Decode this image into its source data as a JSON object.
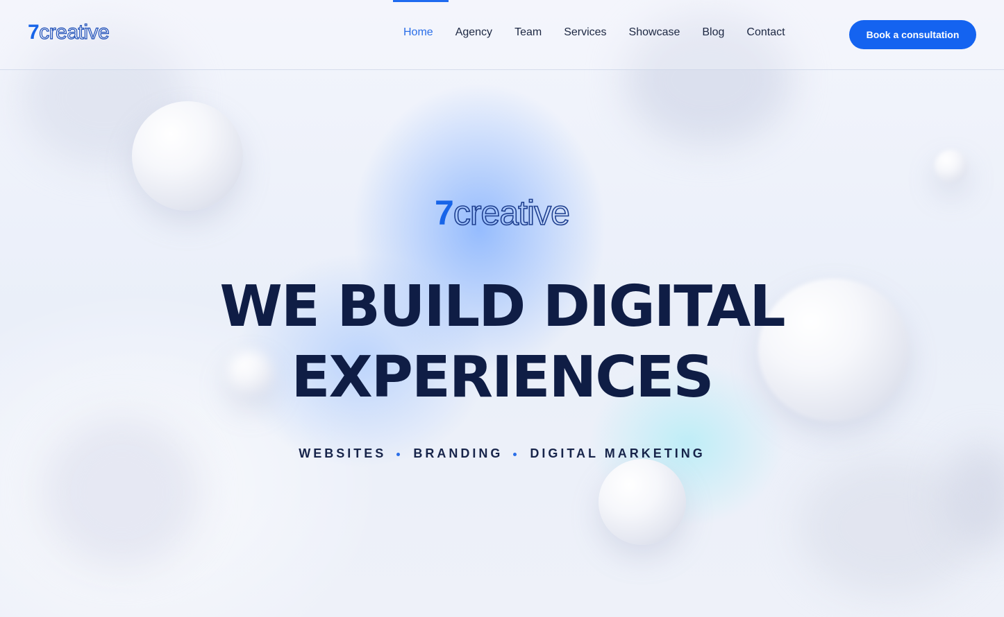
{
  "brand": {
    "logo_number": "7",
    "logo_word": "creative"
  },
  "nav": {
    "items": [
      {
        "label": "Home",
        "active": true
      },
      {
        "label": "Agency",
        "active": false
      },
      {
        "label": "Team",
        "active": false
      },
      {
        "label": "Services",
        "active": false
      },
      {
        "label": "Showcase",
        "active": false
      },
      {
        "label": "Blog",
        "active": false
      },
      {
        "label": "Contact",
        "active": false
      }
    ],
    "cta_label": "Book a consultation"
  },
  "hero": {
    "logo_number": "7",
    "logo_word": "creative",
    "headline_line1": "WE BUILD DIGITAL",
    "headline_line2": "EXPERIENCES",
    "tagline_items": [
      "WEBSITES",
      "BRANDING",
      "DIGITAL MARKETING"
    ]
  },
  "colors": {
    "accent": "#1463f0",
    "headline": "#0f1d45",
    "nav_text": "#1c2742",
    "active_nav": "#2a6ee8"
  }
}
